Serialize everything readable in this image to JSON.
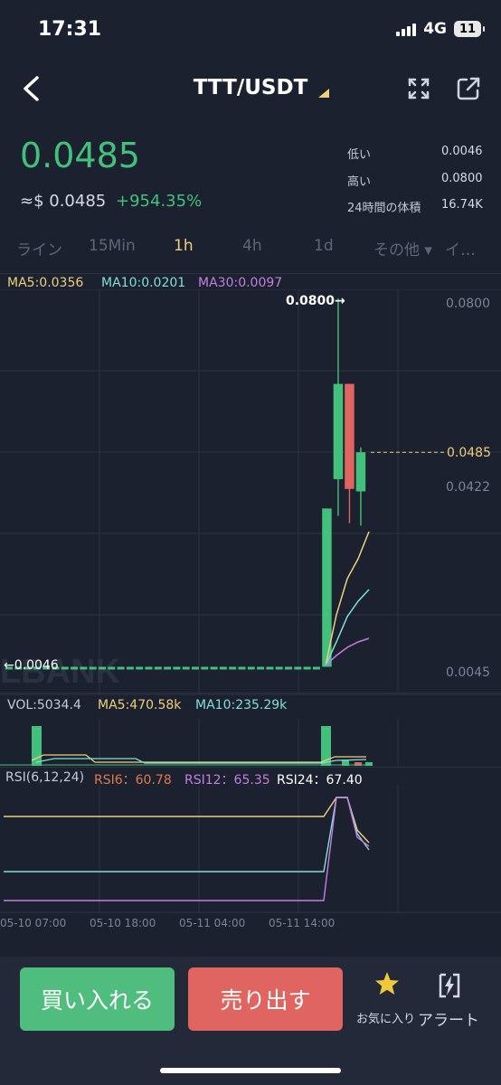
{
  "status": {
    "time": "17:31",
    "network": "4G",
    "battery": "11"
  },
  "header": {
    "title": "TTT/USDT"
  },
  "price": {
    "last": "0.0485",
    "usd": "≈$ 0.0485",
    "change": "+954.35%"
  },
  "stats": [
    {
      "label": "低い",
      "value": "0.0046"
    },
    {
      "label": "高い",
      "value": "0.0800"
    },
    {
      "label": "24時間の体積",
      "value": "16.74K"
    }
  ],
  "tabs": [
    "ライン",
    "15Min",
    "1h",
    "4h",
    "1d",
    "その他 ▾",
    "イ…"
  ],
  "active_tab": "1h",
  "ma": {
    "ma5": "MA5:0.0356",
    "ma10": "MA10:0.0201",
    "ma30": "MA30:0.0097"
  },
  "price_axis": {
    "top": "0.0800",
    "mid": "0.0422",
    "bottom": "0.0045",
    "current": "0.0485"
  },
  "markers": {
    "high": "0.0800→",
    "low": "←0.0046"
  },
  "watermark": "LBANK",
  "vol": {
    "vol": "VOL:5034.4",
    "ma5": "MA5:470.58k",
    "ma10": "MA10:235.29k"
  },
  "rsi": {
    "label": "RSI(6,12,24)",
    "rsi6": "RSI6：60.78",
    "rsi12": "RSI12：65.35",
    "rsi24": "RSI24：67.40"
  },
  "time_axis": [
    "05-10 07:00",
    "05-10 18:00",
    "05-11 04:00",
    "05-11 14:00"
  ],
  "actions": {
    "buy": "買い入れる",
    "sell": "売り出す",
    "favorite": "お気に入り",
    "alert": "アラート"
  },
  "colors": {
    "up": "#43c07b",
    "down": "#e0645f",
    "ma5": "#f0cf7b",
    "ma10": "#7fe0d6",
    "ma30": "#c77de0",
    "bg": "#1c2130"
  },
  "chart_data": {
    "type": "candlestick",
    "interval": "1h",
    "y_range": [
      0.0045,
      0.08
    ],
    "flat_price": 0.0046,
    "candles": [
      {
        "open": 0.0046,
        "close": 0.0046,
        "high": 0.0046,
        "low": 0.0046,
        "repeat": 34
      },
      {
        "open": 0.0046,
        "close": 0.037,
        "high": 0.037,
        "low": 0.0046
      },
      {
        "open": 0.043,
        "close": 0.0625,
        "high": 0.08,
        "low": 0.0355
      },
      {
        "open": 0.0625,
        "close": 0.041,
        "high": 0.0625,
        "low": 0.034
      },
      {
        "open": 0.0405,
        "close": 0.0485,
        "high": 0.0495,
        "low": 0.0335
      }
    ],
    "current_price": 0.0485
  }
}
